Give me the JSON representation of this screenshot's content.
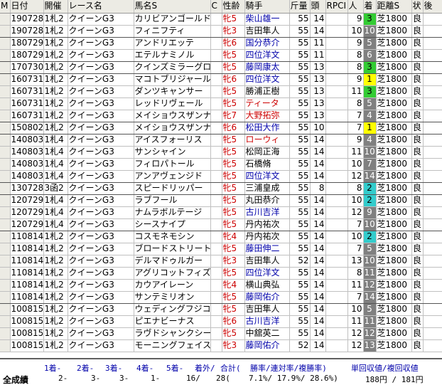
{
  "header": [
    "M",
    "日付",
    "開催",
    "レース名",
    "馬名S",
    "C",
    "性齢",
    "騎手",
    "斤量",
    "頭",
    "RPCI",
    "人",
    "着",
    "距離S",
    "状",
    "後"
  ],
  "rows": [
    {
      "date": "190728",
      "venue": "1札2",
      "race": "クイーンG3",
      "horse": "カリビアンゴールド",
      "c": "",
      "sexage": "牝5",
      "sexcls": "red",
      "jockey": "柴山雄一",
      "jcls": "blue",
      "wt": "55",
      "heads": "14",
      "rpci": "",
      "ninki": "9",
      "rank": "3",
      "rcls": "rk3",
      "dist": "芝1800",
      "cond": "良"
    },
    {
      "date": "190728",
      "venue": "1札2",
      "race": "クイーンG3",
      "horse": "フィニフティ",
      "c": "",
      "sexage": "牝3",
      "sexcls": "red",
      "jockey": "吉田隼人",
      "jcls": "",
      "wt": "55",
      "heads": "14",
      "rpci": "",
      "ninki": "10",
      "rank": "10",
      "rcls": "",
      "dist": "芝1800",
      "cond": "良"
    },
    {
      "date": "180729",
      "venue": "1札2",
      "race": "クイーンG3",
      "horse": "アンドリエッテ",
      "c": "",
      "sexage": "牝6",
      "sexcls": "red",
      "jockey": "国分恭介",
      "jcls": "blue",
      "wt": "55",
      "heads": "11",
      "rpci": "",
      "ninki": "9",
      "rank": "5",
      "rcls": "",
      "dist": "芝1800",
      "cond": "良"
    },
    {
      "date": "180729",
      "venue": "1札2",
      "race": "クイーンG3",
      "horse": "エテルナミノル",
      "c": "",
      "sexage": "牝5",
      "sexcls": "red",
      "jockey": "四位洋文",
      "jcls": "blue",
      "wt": "55",
      "heads": "11",
      "rpci": "",
      "ninki": "8",
      "rank": "6",
      "rcls": "",
      "dist": "芝1800",
      "cond": "良"
    },
    {
      "date": "170730",
      "venue": "1札2",
      "race": "クイーンG3",
      "horse": "クインズミラーグロ",
      "c": "",
      "sexage": "牝5",
      "sexcls": "red",
      "jockey": "藤岡康太",
      "jcls": "blue",
      "wt": "55",
      "heads": "13",
      "rpci": "",
      "ninki": "8",
      "rank": "3",
      "rcls": "rk3",
      "dist": "芝1800",
      "cond": "良"
    },
    {
      "date": "160731",
      "venue": "1札2",
      "race": "クイーンG3",
      "horse": "マコトブリジャール",
      "c": "",
      "sexage": "牝6",
      "sexcls": "red",
      "jockey": "四位洋文",
      "jcls": "blue",
      "wt": "55",
      "heads": "13",
      "rpci": "",
      "ninki": "9",
      "rank": "1",
      "rcls": "rk1",
      "dist": "芝1800",
      "cond": "良"
    },
    {
      "date": "160731",
      "venue": "1札2",
      "race": "クイーンG3",
      "horse": "ダンツキャンサー",
      "c": "",
      "sexage": "牝5",
      "sexcls": "red",
      "jockey": "勝浦正樹",
      "jcls": "",
      "wt": "55",
      "heads": "13",
      "rpci": "",
      "ninki": "11",
      "rank": "3",
      "rcls": "rk3",
      "dist": "芝1800",
      "cond": "良"
    },
    {
      "date": "160731",
      "venue": "1札2",
      "race": "クイーンG3",
      "horse": "レッドリヴェール",
      "c": "",
      "sexage": "牝5",
      "sexcls": "red",
      "jockey": "ティータ",
      "jcls": "red",
      "wt": "55",
      "heads": "13",
      "rpci": "",
      "ninki": "8",
      "rank": "5",
      "rcls": "",
      "dist": "芝1800",
      "cond": "良"
    },
    {
      "date": "160731",
      "venue": "1札2",
      "race": "クイーンG3",
      "horse": "メイショウスザンナ",
      "c": "",
      "sexage": "牝7",
      "sexcls": "red",
      "jockey": "大野拓弥",
      "jcls": "red",
      "wt": "55",
      "heads": "13",
      "rpci": "",
      "ninki": "7",
      "rank": "4",
      "rcls": "",
      "dist": "芝1800",
      "cond": "良"
    },
    {
      "date": "150802",
      "venue": "1札2",
      "race": "クイーンG3",
      "horse": "メイショウスザンナ",
      "c": "",
      "sexage": "牝6",
      "sexcls": "red",
      "jockey": "松田大作",
      "jcls": "blue",
      "wt": "55",
      "heads": "10",
      "rpci": "",
      "ninki": "7",
      "rank": "1",
      "rcls": "rk1",
      "dist": "芝1800",
      "cond": "良"
    },
    {
      "date": "140803",
      "venue": "1札4",
      "race": "クイーンG3",
      "horse": "アイスフォーリス",
      "c": "",
      "sexage": "牝5",
      "sexcls": "red",
      "jockey": "ローウィ",
      "jcls": "red",
      "wt": "55",
      "heads": "14",
      "rpci": "",
      "ninki": "9",
      "rank": "4",
      "rcls": "",
      "dist": "芝1800",
      "cond": "良"
    },
    {
      "date": "140803",
      "venue": "1札4",
      "race": "クイーンG3",
      "horse": "サンシャイン",
      "c": "",
      "sexage": "牝5",
      "sexcls": "red",
      "jockey": "松岡正海",
      "jcls": "",
      "wt": "55",
      "heads": "14",
      "rpci": "",
      "ninki": "11",
      "rank": "10",
      "rcls": "",
      "dist": "芝1800",
      "cond": "良"
    },
    {
      "date": "140803",
      "venue": "1札4",
      "race": "クイーンG3",
      "horse": "フィロパトール",
      "c": "",
      "sexage": "牝5",
      "sexcls": "red",
      "jockey": "石橋脩",
      "jcls": "",
      "wt": "55",
      "heads": "14",
      "rpci": "",
      "ninki": "10",
      "rank": "7",
      "rcls": "",
      "dist": "芝1800",
      "cond": "良"
    },
    {
      "date": "140803",
      "venue": "1札4",
      "race": "クイーンG3",
      "horse": "アンアヴェンジド",
      "c": "",
      "sexage": "牝5",
      "sexcls": "red",
      "jockey": "四位洋文",
      "jcls": "blue",
      "wt": "55",
      "heads": "14",
      "rpci": "",
      "ninki": "12",
      "rank": "14",
      "rcls": "",
      "dist": "芝1800",
      "cond": "良"
    },
    {
      "date": "130728",
      "venue": "3函2",
      "race": "クイーンG3",
      "horse": "スピードリッパー",
      "c": "",
      "sexage": "牝5",
      "sexcls": "red",
      "jockey": "三浦皇成",
      "jcls": "",
      "wt": "55",
      "heads": "8",
      "rpci": "",
      "ninki": "8",
      "rank": "2",
      "rcls": "rk2",
      "dist": "芝1800",
      "cond": "良"
    },
    {
      "date": "120729",
      "venue": "1札4",
      "race": "クイーンG3",
      "horse": "ラブフール",
      "c": "",
      "sexage": "牝5",
      "sexcls": "red",
      "jockey": "丸田恭介",
      "jcls": "",
      "wt": "55",
      "heads": "14",
      "rpci": "",
      "ninki": "10",
      "rank": "2",
      "rcls": "rk2",
      "dist": "芝1800",
      "cond": "良"
    },
    {
      "date": "120729",
      "venue": "1札4",
      "race": "クイーンG3",
      "horse": "ナムラボルテージ",
      "c": "",
      "sexage": "牝5",
      "sexcls": "red",
      "jockey": "古川吉洋",
      "jcls": "blue",
      "wt": "55",
      "heads": "14",
      "rpci": "",
      "ninki": "12",
      "rank": "9",
      "rcls": "",
      "dist": "芝1800",
      "cond": "良"
    },
    {
      "date": "120729",
      "venue": "1札4",
      "race": "クイーンG3",
      "horse": "シースナイプ",
      "c": "",
      "sexage": "牝5",
      "sexcls": "red",
      "jockey": "丹内祐次",
      "jcls": "",
      "wt": "55",
      "heads": "14",
      "rpci": "",
      "ninki": "7",
      "rank": "10",
      "rcls": "",
      "dist": "芝1800",
      "cond": "良"
    },
    {
      "date": "110814",
      "venue": "1札2",
      "race": "クイーンG3",
      "horse": "コスモネモシン",
      "c": "",
      "sexage": "牝4",
      "sexcls": "red",
      "jockey": "丹内祐次",
      "jcls": "",
      "wt": "55",
      "heads": "14",
      "rpci": "",
      "ninki": "10",
      "rank": "2",
      "rcls": "rk2",
      "dist": "芝1800",
      "cond": "良"
    },
    {
      "date": "110814",
      "venue": "1札2",
      "race": "クイーンG3",
      "horse": "ブロードストリート",
      "c": "",
      "sexage": "牝5",
      "sexcls": "red",
      "jockey": "藤田伸二",
      "jcls": "blue",
      "wt": "55",
      "heads": "14",
      "rpci": "",
      "ninki": "7",
      "rank": "5",
      "rcls": "",
      "dist": "芝1800",
      "cond": "良"
    },
    {
      "date": "110814",
      "venue": "1札2",
      "race": "クイーンG3",
      "horse": "デルマドゥルガー",
      "c": "",
      "sexage": "牝3",
      "sexcls": "red",
      "jockey": "吉田隼人",
      "jcls": "",
      "wt": "52",
      "heads": "14",
      "rpci": "",
      "ninki": "13",
      "rank": "10",
      "rcls": "",
      "dist": "芝1800",
      "cond": "良"
    },
    {
      "date": "110814",
      "venue": "1札2",
      "race": "クイーンG3",
      "horse": "アグリコットフィズ",
      "c": "",
      "sexage": "牝5",
      "sexcls": "red",
      "jockey": "四位洋文",
      "jcls": "blue",
      "wt": "55",
      "heads": "14",
      "rpci": "",
      "ninki": "8",
      "rank": "11",
      "rcls": "",
      "dist": "芝1800",
      "cond": "良"
    },
    {
      "date": "110814",
      "venue": "1札2",
      "race": "クイーンG3",
      "horse": "カウアイレーン",
      "c": "",
      "sexage": "牝4",
      "sexcls": "red",
      "jockey": "横山典弘",
      "jcls": "",
      "wt": "55",
      "heads": "14",
      "rpci": "",
      "ninki": "11",
      "rank": "12",
      "rcls": "",
      "dist": "芝1800",
      "cond": "良"
    },
    {
      "date": "110814",
      "venue": "1札2",
      "race": "クイーンG3",
      "horse": "サンテミリオン",
      "c": "",
      "sexage": "牝5",
      "sexcls": "red",
      "jockey": "藤岡佑介",
      "jcls": "blue",
      "wt": "55",
      "heads": "14",
      "rpci": "",
      "ninki": "7",
      "rank": "14",
      "rcls": "",
      "dist": "芝1800",
      "cond": "良"
    },
    {
      "date": "100815",
      "venue": "1札2",
      "race": "クイーンG3",
      "horse": "ウェディングフジコ",
      "c": "",
      "sexage": "牝5",
      "sexcls": "red",
      "jockey": "吉田隼人",
      "jcls": "",
      "wt": "55",
      "heads": "14",
      "rpci": "",
      "ninki": "10",
      "rank": "5",
      "rcls": "",
      "dist": "芝1800",
      "cond": "良"
    },
    {
      "date": "100815",
      "venue": "1札2",
      "race": "クイーンG3",
      "horse": "ピエナビーナス",
      "c": "",
      "sexage": "牝6",
      "sexcls": "red",
      "jockey": "古川吉洋",
      "jcls": "blue",
      "wt": "55",
      "heads": "14",
      "rpci": "",
      "ninki": "11",
      "rank": "11",
      "rcls": "",
      "dist": "芝1800",
      "cond": "良"
    },
    {
      "date": "100815",
      "venue": "1札2",
      "race": "クイーンG3",
      "horse": "ラヴドシャンクシー",
      "c": "",
      "sexage": "牝5",
      "sexcls": "red",
      "jockey": "中舘英二",
      "jcls": "",
      "wt": "55",
      "heads": "14",
      "rpci": "",
      "ninki": "12",
      "rank": "12",
      "rcls": "",
      "dist": "芝1800",
      "cond": "良"
    },
    {
      "date": "100815",
      "venue": "1札2",
      "race": "クイーンG3",
      "horse": "モーニングフェイス",
      "c": "",
      "sexage": "牝3",
      "sexcls": "red",
      "jockey": "藤岡佑介",
      "jcls": "blue",
      "wt": "52",
      "heads": "14",
      "rpci": "",
      "ninki": "12",
      "rank": "13",
      "rcls": "",
      "dist": "芝1800",
      "cond": "良"
    }
  ],
  "summary": {
    "label": "全成績",
    "h1": "1着-",
    "h2": "2着-",
    "h3": "3着-",
    "h4": "4着-",
    "h5": "5着-",
    "hout": "着外/",
    "htotal": "合計(",
    "hrates": "勝率/連対率/複勝率)",
    "hret": "単回収値/複回収値",
    "v1": "2-",
    "v2": "3-",
    "v3": "3-",
    "v4": "1-",
    "v5": "16/",
    "vtotal": "28(",
    "vrates": "7.1%/ 17.9%/ 28.6%)",
    "vret": "188円 / 181円"
  },
  "colors": {
    "header_bg": "#ecebe4",
    "rank1": "#ffff00",
    "rank2": "#33cccc",
    "rank3": "#33cc33",
    "rank_other": "#808080"
  }
}
